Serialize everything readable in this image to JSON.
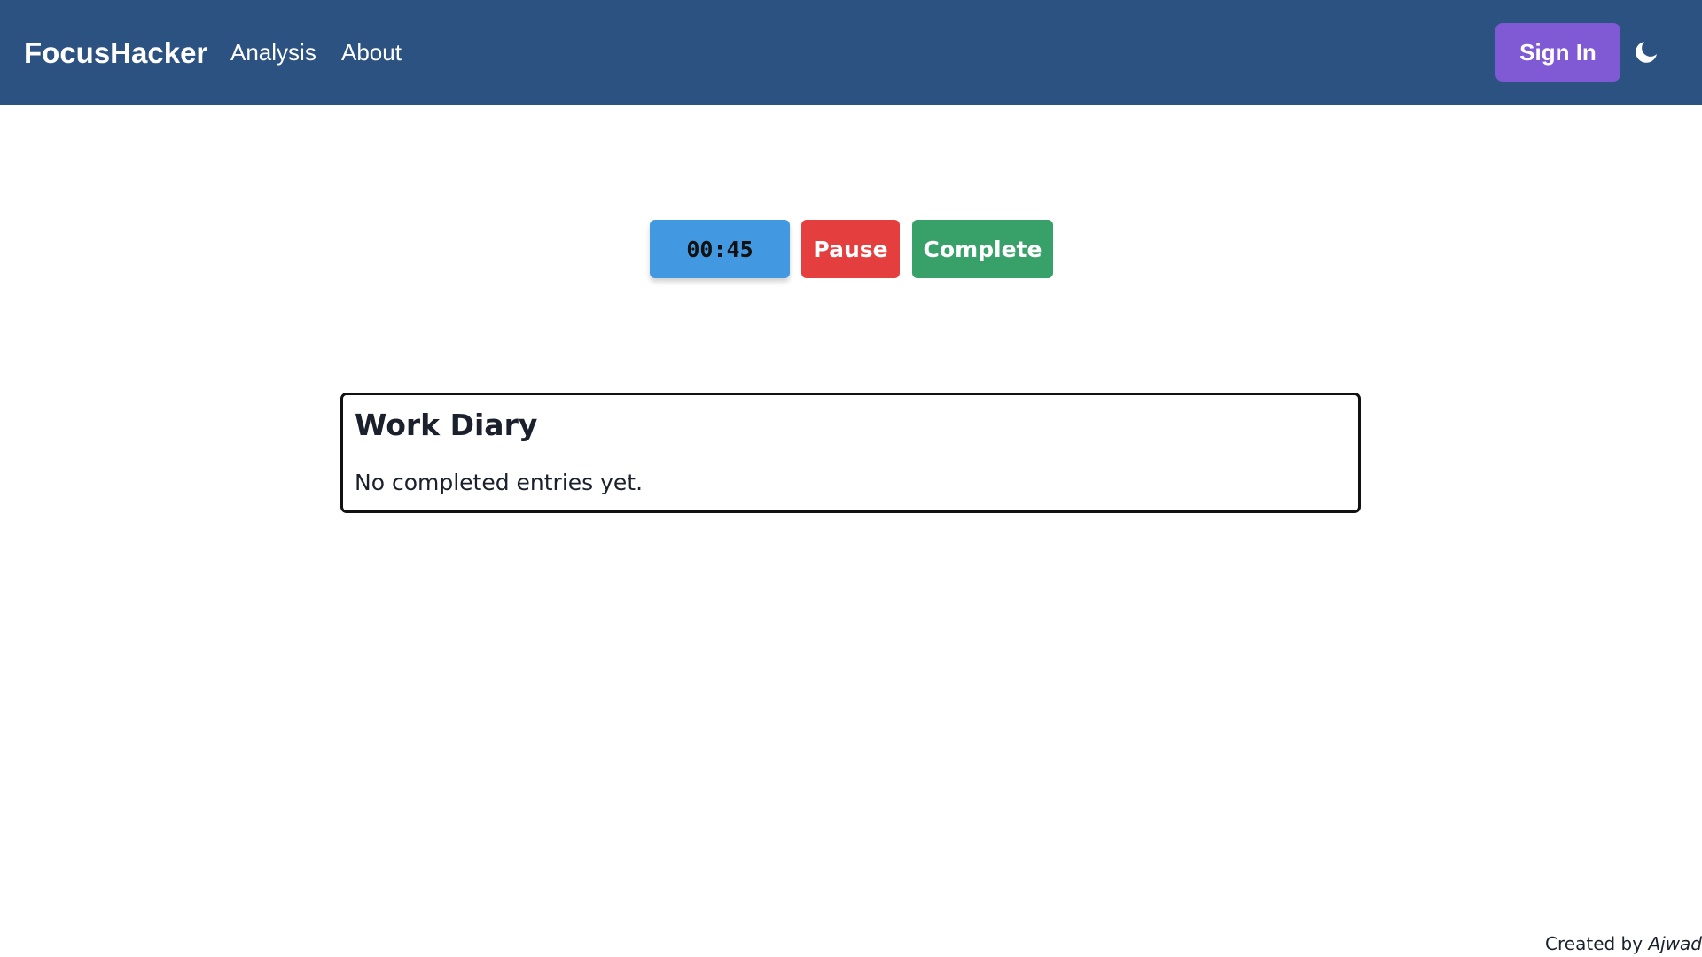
{
  "navbar": {
    "brand": "FocusHacker",
    "links": [
      "Analysis",
      "About"
    ],
    "sign_in_label": "Sign In",
    "theme_toggle_icon": "moon-icon",
    "background_color": "#2c5282",
    "sign_in_color": "#805ad5"
  },
  "timer": {
    "display": "00:45",
    "pause_label": "Pause",
    "complete_label": "Complete",
    "colors": {
      "timer": "#4299e1",
      "pause": "#e53e3e",
      "complete": "#38a169"
    }
  },
  "work_diary": {
    "title": "Work Diary",
    "empty_message": "No completed entries yet."
  },
  "footer": {
    "prefix": "Created by",
    "author": "Ajwad"
  }
}
